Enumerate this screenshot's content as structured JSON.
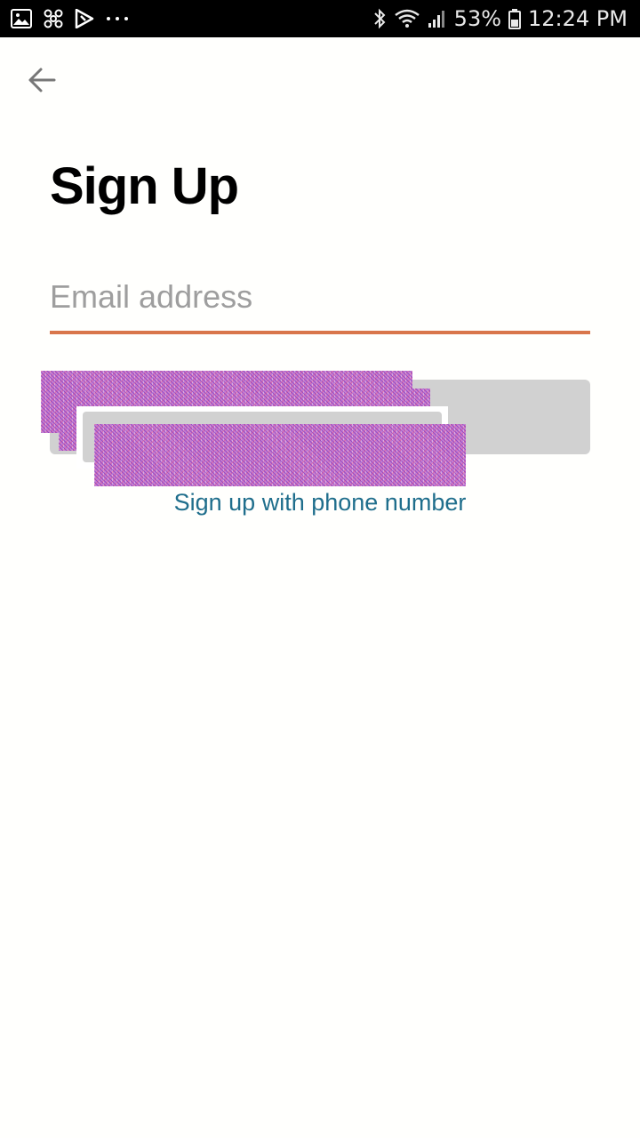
{
  "status_bar": {
    "left_icons": [
      "gallery-icon",
      "fan-icon",
      "play-store-icon",
      "more-dots-icon"
    ],
    "right_icons": [
      "bluetooth-icon",
      "wifi-icon",
      "signal-icon",
      "battery-icon"
    ],
    "battery": "53%",
    "time": "12:24 PM"
  },
  "header": {
    "back_icon": "arrow-left-icon"
  },
  "main": {
    "title": "Sign Up",
    "email_placeholder": "Email address",
    "email_value": "",
    "continue_label": "",
    "alt_signup_link": "Sign up with phone number"
  },
  "colors": {
    "status_bar_bg": "#000000",
    "page_bg": "#fffffd",
    "input_underline": "#d9764b",
    "button_bg": "#d1d1d1",
    "link": "#1f6e8c"
  }
}
